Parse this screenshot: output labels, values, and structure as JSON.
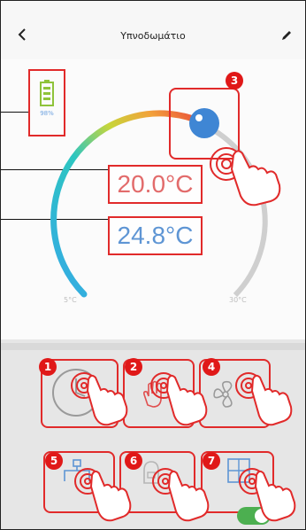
{
  "header": {
    "back_icon": "chevron-left-icon",
    "title": "Υπνοδωμάτιο",
    "edit_icon": "pencil-icon"
  },
  "battery": {
    "icon": "battery-icon",
    "percent": "98%"
  },
  "thermostat": {
    "setpoint": "20.0°C",
    "current": "24.8°C",
    "min_label": "5°C",
    "max_label": "30°C",
    "colors": {
      "cold": "#35a9e6",
      "mid": "#c7d63a",
      "warm": "#f2a23a",
      "hot": "#e8433a",
      "knob": "#3f86d4"
    }
  },
  "badges": [
    "1",
    "2",
    "3",
    "4",
    "5",
    "6",
    "7"
  ],
  "controls": [
    {
      "id": "1",
      "icon": "clock-icon"
    },
    {
      "id": "2",
      "icon": "hand-stop-icon"
    },
    {
      "id": "4",
      "icon": "fan-icon"
    },
    {
      "id": "5",
      "icon": "child-lock-icon"
    },
    {
      "id": "6",
      "icon": "eco-mode-icon"
    },
    {
      "id": "7",
      "icon": "window-open-icon",
      "toggle_on": true
    }
  ],
  "annotation_color": "#e12a2a"
}
